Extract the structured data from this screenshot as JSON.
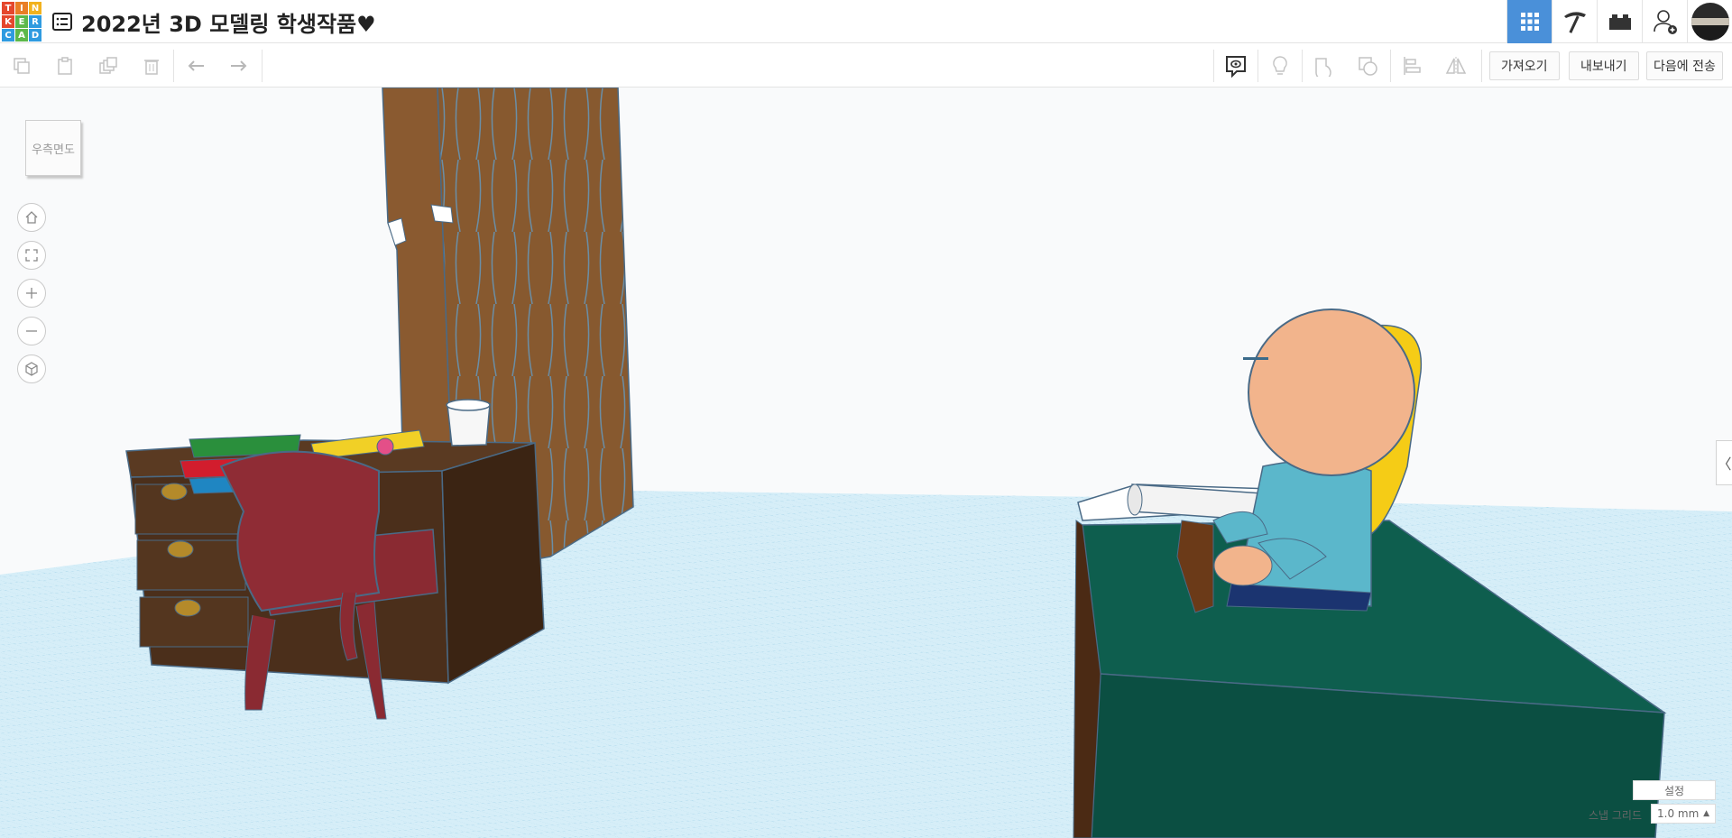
{
  "logo": {
    "letters": [
      "T",
      "I",
      "N",
      "K",
      "E",
      "R",
      "C",
      "A",
      "D"
    ],
    "colors": [
      "#e5472d",
      "#e97e26",
      "#f2b21e",
      "#e5472d",
      "#5db84a",
      "#2f9be0",
      "#2f9be0",
      "#5db84a",
      "#2f9be0"
    ]
  },
  "header": {
    "title": "2022년 3D 모델링 학생작품♥",
    "tabs": [
      {
        "icon": "grid-icon",
        "active": true
      },
      {
        "icon": "pickaxe-icon",
        "active": false
      },
      {
        "icon": "brick-icon",
        "active": false
      },
      {
        "icon": "add-user-icon",
        "active": false
      },
      {
        "icon": "avatar",
        "active": false
      }
    ]
  },
  "toolbar": {
    "left_icons": [
      "copy-icon",
      "paste-icon",
      "duplicate-icon",
      "delete-icon",
      "undo-icon",
      "redo-icon"
    ],
    "right_icons": [
      "notes-icon",
      "light-bulb-icon",
      "shape-icon",
      "hole-icon",
      "align-icon",
      "mirror-icon"
    ],
    "import_label": "가져오기",
    "export_label": "내보내기",
    "send_label": "다음에 전송"
  },
  "viewport": {
    "viewcube_label": "우측면도",
    "nav_icons": [
      "home-icon",
      "fit-icon",
      "zoom-in-icon",
      "zoom-out-icon",
      "perspective-icon"
    ],
    "settings_label": "설정",
    "snap_label": "스냅 그리드",
    "snap_value": "1.0 mm",
    "collapse_label": "〈"
  },
  "colors": {
    "accent": "#4a90d9",
    "grid": "#bfe3f0",
    "wood": "#8a5a32",
    "desk": "#4a2f1c",
    "bed": "#0e5a4b",
    "skin": "#f2b48c",
    "shirt": "#5eb8cc",
    "hair": "#f5cc16"
  }
}
